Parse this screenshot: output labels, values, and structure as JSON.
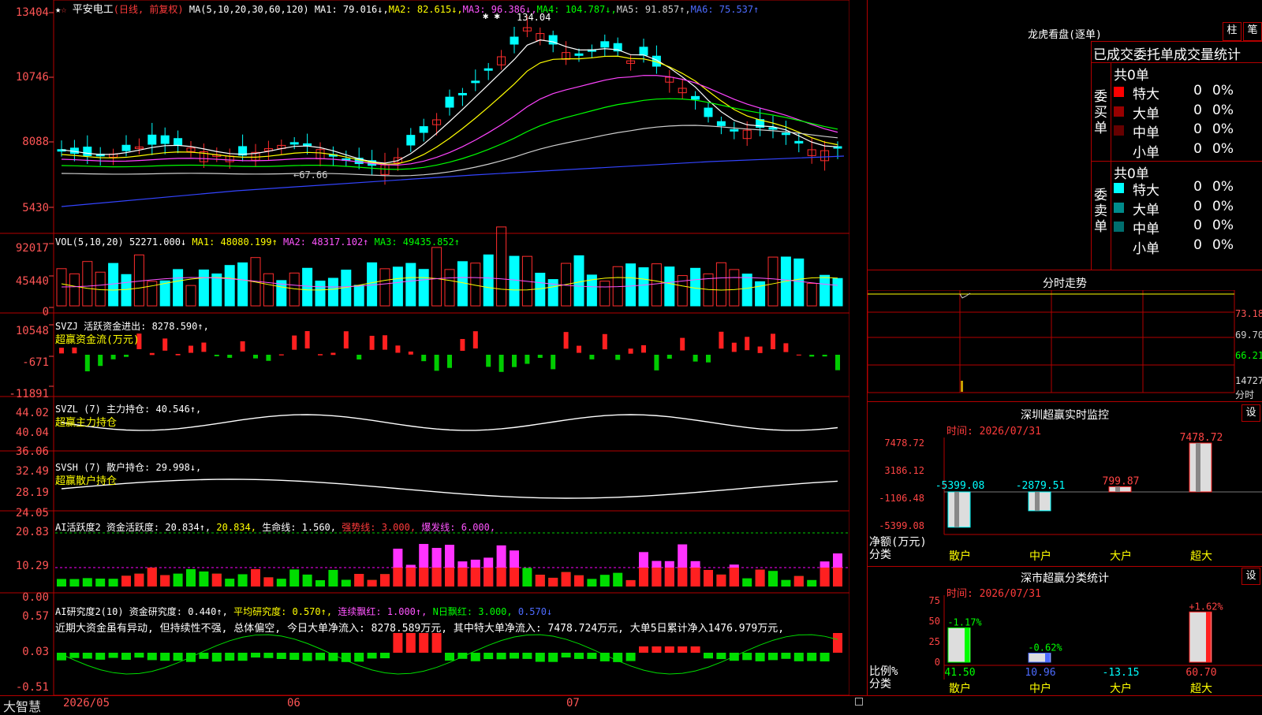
{
  "stock": {
    "name": "平安电工",
    "period": "(日线, 前复权)",
    "ma_def": "MA(5,10,20,30,60,120)",
    "ma": [
      {
        "t": "MA1: 79.016↓",
        "c": "#ffffff"
      },
      {
        "t": "MA2: 82.615↓",
        "c": "#ffff00"
      },
      {
        "t": "MA3: 96.386↓",
        "c": "#ff55ff"
      },
      {
        "t": "MA4: 104.787↓",
        "c": "#00ff00"
      },
      {
        "t": "MA5: 91.857↑",
        "c": "#cfcfcf"
      },
      {
        "t": "MA6: 75.537↑",
        "c": "#4d6bff"
      }
    ],
    "yaxis": [
      "13404",
      "10746",
      "8088",
      "5430"
    ],
    "high_note": "134.04",
    "low_note": "←67.66"
  },
  "vol": {
    "def": "VOL(5,10,20)",
    "v": "52271.000↓",
    "ma1": "MA1: 48080.199↑",
    "ma2": "MA2: 48317.102↑",
    "ma3": "MA3: 49435.852↑",
    "yaxis": [
      "92017",
      "45440",
      "0"
    ]
  },
  "svzj": {
    "title": "SVZJ  活跃资金进出: 8278.590↑,",
    "sub": "超赢资金流(万元)",
    "yaxis": [
      "10548",
      "-671",
      "-11891"
    ]
  },
  "svzl": {
    "title": "SVZL (7) 主力持仓: 40.546↑,",
    "sub": "超赢主力持仓",
    "yaxis": [
      "44.02",
      "40.04",
      "36.06"
    ]
  },
  "svsh": {
    "title": "SVSH (7) 散户持仓: 29.998↓,",
    "sub": "超赢散户持仓",
    "yaxis": [
      "32.49",
      "28.19",
      "24.05"
    ]
  },
  "ai2": {
    "a": "AI活跃度2 资金活跃度: 20.834↑,",
    "b": "20.834,",
    "c": "生命线: 1.560,",
    "d": "强势线: 3.000,",
    "e": "爆发线: 6.000,",
    "yaxis": [
      "20.83",
      "10.29",
      "0.00"
    ]
  },
  "ai3": {
    "a": "AI研究度2(10) 资金研究度: 0.440↑,",
    "b": "平均研究度: 0.570↑,",
    "c": "连续飘红: 1.000↑,",
    "d": "N日飘红: 3.000,",
    "e": "0.570↓",
    "comment": "近期大资金虽有异动, 但持续性不强, 总体偏空, 今日大单净流入: 8278.589万元, 其中特大单净流入: 7478.724万元, 大单5日累计净入1476.979万元,",
    "yaxis": [
      "0.57",
      "0.03",
      "-0.51"
    ]
  },
  "xaxis": {
    "brand": "大智慧",
    "d1": "2026/05",
    "d2": "06",
    "d3": "07"
  },
  "right": {
    "header": "龙虎看盘(逐单)",
    "btn1": "柱",
    "btn2": "笔",
    "stat_title": "已成交委托单成交量统计",
    "buy_label": "委买单",
    "sell_label": "委卖单",
    "buy_total": "共0单",
    "sell_total": "共0单",
    "buy_rows": [
      {
        "n": "特大",
        "v": "0",
        "p": "0%",
        "c": "#ff0000"
      },
      {
        "n": "大单",
        "v": "0",
        "p": "0%",
        "c": "#990000"
      },
      {
        "n": "中单",
        "v": "0",
        "p": "0%",
        "c": "#660000"
      },
      {
        "n": "小单",
        "v": "0",
        "p": "0%",
        "c": "#000000"
      }
    ],
    "sell_rows": [
      {
        "n": "特大",
        "v": "0",
        "p": "0%",
        "c": "#00ffff"
      },
      {
        "n": "大单",
        "v": "0",
        "p": "0%",
        "c": "#008b8b"
      },
      {
        "n": "中单",
        "v": "0",
        "p": "0%",
        "c": "#006e6e"
      },
      {
        "n": "小单",
        "v": "0",
        "p": "0%",
        "c": "#000000"
      }
    ],
    "fenshi_title": "分时走势",
    "fenshi_y": [
      "73.18",
      "69.70",
      "66.21",
      "14727"
    ],
    "fenshi_unit": "分时",
    "monitor_title": "深圳超赢实时监控",
    "set": "设",
    "time1": "时间: 2026/07/31",
    "mon_y": [
      "7478.72",
      "3186.12",
      "-1106.48",
      "-5399.08"
    ],
    "mon_vals": [
      "-5399.08",
      "-2879.51",
      "799.87",
      "7478.72"
    ],
    "net_label": "净额(万元)",
    "cls_label": "分类",
    "cats": [
      "散户",
      "中户",
      "大户",
      "超大"
    ],
    "cls_title": "深市超赢分类统计",
    "time2": "时间: 2026/07/31",
    "cls_y": [
      "75",
      "50",
      "25",
      "0"
    ],
    "cls_pct": [
      "-1.17%",
      "-0.62%",
      "",
      "+1.62%"
    ],
    "cls_vals": [
      "41.50",
      "10.96",
      "-13.15",
      "60.70"
    ],
    "ratio_label": "比例%"
  }
}
